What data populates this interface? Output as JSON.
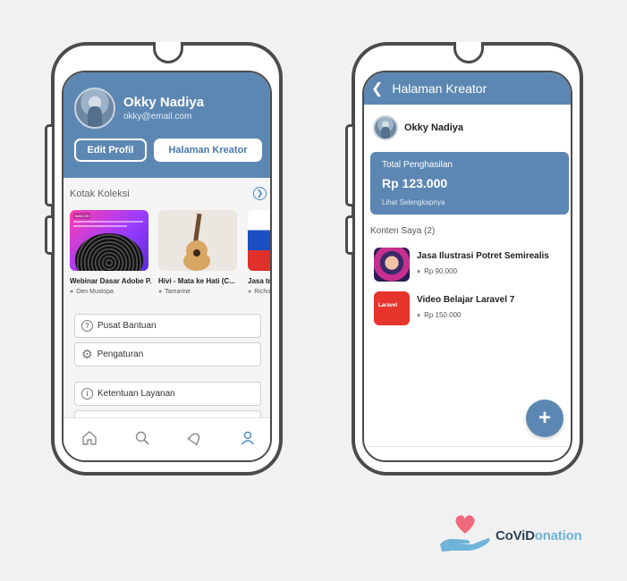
{
  "profile_screen": {
    "user_name": "Okky Nadiya",
    "user_email": "okky@email.com",
    "edit_profile_label": "Edit Profil",
    "creator_page_label": "Halaman Kreator",
    "collection_title": "Kotak Koleksi",
    "collection_items": [
      {
        "title": "Webinar Dasar Adobe P...",
        "author": "Den Mustopa",
        "tag": "batch 25"
      },
      {
        "title": "Hivi - Mata ke Hati (C...",
        "author": "Tamarine"
      },
      {
        "title": "Jasa tra",
        "author": "Richo"
      }
    ],
    "menu": {
      "help": "Pusat Bantuan",
      "settings": "Pengaturan",
      "terms": "Ketentuan Layanan"
    },
    "nav": [
      "home-icon",
      "search-icon",
      "bell-icon",
      "user-icon"
    ]
  },
  "creator_screen": {
    "title": "Halaman Kreator",
    "user_name": "Okky Nadiya",
    "earnings_label": "Total Penghasilan",
    "earnings_value": "Rp 123.000",
    "earnings_link": "Lihat Selengkapnya",
    "content_title": "Konten Saya (2)",
    "contents": [
      {
        "title": "Jasa Ilustrasi Potret Semirealis",
        "price": "Rp 90.000"
      },
      {
        "title": "Video Belajar Laravel 7",
        "price": "Rp 150.000",
        "thumb_text": "Laravel"
      }
    ],
    "fab_label": "+"
  },
  "brand": {
    "part1": "CoViD",
    "part2": "onation",
    "accent": "#5d87b3"
  }
}
